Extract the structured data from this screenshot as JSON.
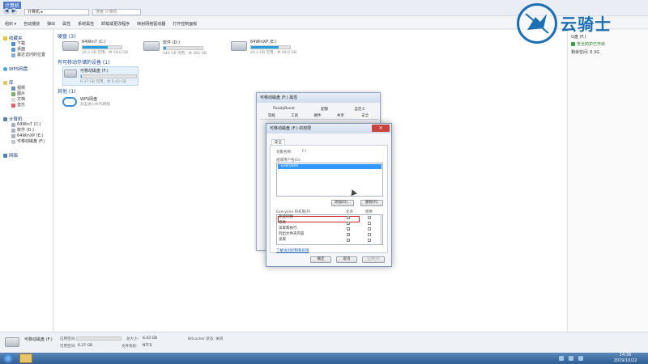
{
  "window": {
    "title": "计算机",
    "address": "计算机 ▸",
    "search_placeholder": "搜索 计算机"
  },
  "toolbar": {
    "items": [
      "组织 ▾",
      "自动播放",
      "弹出",
      "属性",
      "系统属性",
      "卸载或更改程序",
      "映射网络驱动器",
      "打开控制面板"
    ]
  },
  "sidebar": {
    "favorites": {
      "label": "收藏夹",
      "items": [
        "下载",
        "桌面",
        "最近访问的位置"
      ]
    },
    "wps": {
      "label": "WPS网盘"
    },
    "library": {
      "label": "库",
      "items": [
        "视频",
        "图片",
        "文档",
        "音乐"
      ]
    },
    "computer": {
      "label": "计算机",
      "items": [
        "64Win7 (C:)",
        "软件 (D:)",
        "64WinXP (E:)",
        "可移动磁盘 (F:)"
      ]
    },
    "network": {
      "label": "网络"
    }
  },
  "main": {
    "hard_disks": {
      "title": "硬盘 (3)",
      "drives": [
        {
          "name": "64Win7 (C:)",
          "free": "20.5 GB 可用，共 59.0 GB",
          "used_fraction": 0.65
        },
        {
          "name": "软件 (D:)",
          "free": "440 GB 可用，共 465 GB",
          "used_fraction": 0.06
        },
        {
          "name": "64WinXP (E:)",
          "free": "29.2 GB 可用，共 99.0 GB",
          "used_fraction": 0.7
        }
      ]
    },
    "removable": {
      "title": "有可移动存储的设备 (1)",
      "drives": [
        {
          "name": "可移动磁盘 (F:)",
          "free": "6.37 GB 可用，共 6.43 GB",
          "used_fraction": 0.02
        }
      ]
    },
    "other": {
      "title": "其他 (1)",
      "items": [
        {
          "name": "WPS网盘",
          "desc": "双击进入WPS网盘"
        }
      ]
    }
  },
  "rightpane": {
    "drive_label": "G盘 (F:)",
    "bitlocker": "安全的护已开启",
    "free": "剩余空间: 6.3G"
  },
  "status": {
    "name": "可移动磁盘 (F:)",
    "used_label": "已用空间:",
    "free_label": "可用空间:",
    "free_value": "6.37 GB",
    "total_label": "总大小:",
    "total_value": "6.43 GB",
    "fs_label": "文件系统:",
    "fs_value": "NTFS",
    "bitlocker": "BitLocker 状态: 关闭"
  },
  "taskbar": {
    "time": "14:39",
    "date": "2019/10/22"
  },
  "dialog_back": {
    "title": "可移动磁盘 (F:) 属性",
    "tabs_row1": [
      "ReadyBoost",
      "配额",
      "自定义"
    ],
    "tabs_row2": [
      "常规",
      "工具",
      "硬件",
      "共享",
      "安全"
    ]
  },
  "dialog_front": {
    "title": "可移动磁盘 (F:) 的权限",
    "tab": "安全",
    "object_label": "对象名称:",
    "object_value": "F:\\",
    "group_label": "组或用户名(G):",
    "group_selected": "Everyone",
    "add_button": "添加(D)...",
    "remove_button": "删除(R)",
    "perm_header": "Everyone 的权限(P)",
    "allow_header": "允许",
    "deny_header": "拒绝",
    "permissions": [
      {
        "name": "完全控制",
        "allow": false,
        "deny": false
      },
      {
        "name": "修改",
        "allow": true,
        "deny": false
      },
      {
        "name": "读取和执行",
        "allow": true,
        "deny": false
      },
      {
        "name": "列出文件夹内容",
        "allow": true,
        "deny": false
      },
      {
        "name": "读取",
        "allow": true,
        "deny": false
      }
    ],
    "help_link": "了解访问控制和权限",
    "ok_button": "确定",
    "cancel_button": "取消",
    "apply_button": "应用(A)"
  },
  "watermark": {
    "text": "云骑士"
  }
}
